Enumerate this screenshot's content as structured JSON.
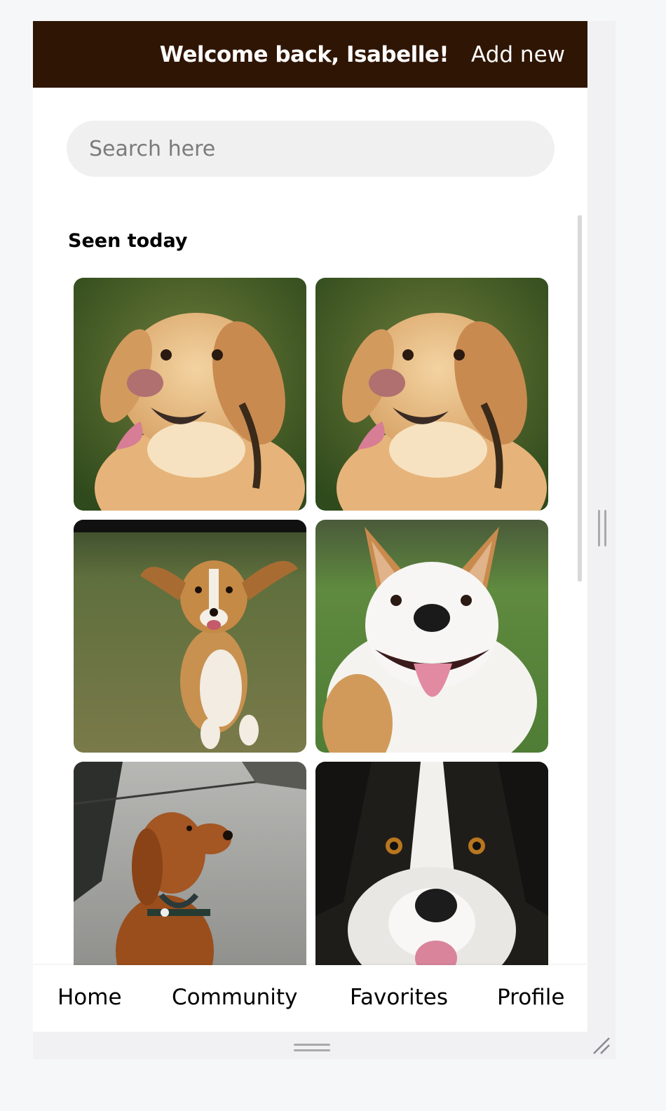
{
  "header": {
    "greeting": "Welcome back, Isabelle!",
    "add_new_label": "Add new",
    "background_color": "#2f1503"
  },
  "search": {
    "placeholder": "Search here",
    "value": ""
  },
  "seen_today": {
    "title": "Seen today",
    "photos": [
      {
        "subject": "golden retriever smiling"
      },
      {
        "subject": "golden retriever smiling"
      },
      {
        "subject": "beagle running on grass"
      },
      {
        "subject": "white terrier smiling"
      },
      {
        "subject": "golden retriever sitting on path"
      },
      {
        "subject": "border collie close-up"
      }
    ]
  },
  "bottom_nav": {
    "items": [
      "Home",
      "Community",
      "Favorites",
      "Profile"
    ]
  }
}
